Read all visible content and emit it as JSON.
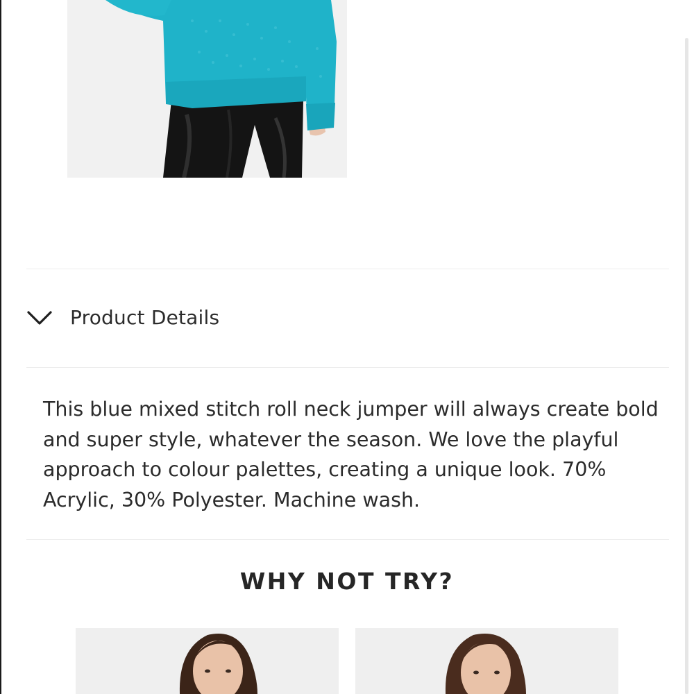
{
  "product": {
    "image_alt": "Model wearing blue mixed stitch roll neck jumper with black trousers"
  },
  "accordion": {
    "label": "Product Details",
    "state": "expanded",
    "icon": "chevron-down-icon"
  },
  "description": {
    "text": "This blue mixed stitch roll neck jumper will always create bold and super style, whatever the season. We love the playful approach to colour palettes, creating a unique look. 70% Acrylic, 30% Polyester. Machine wash."
  },
  "recommendations": {
    "title": "WHY NOT TRY?",
    "items": [
      {
        "image_alt": "Recommended product 1"
      },
      {
        "image_alt": "Recommended product 2"
      }
    ]
  },
  "colors": {
    "jumper": "#1fb3c9",
    "trousers": "#141414",
    "image_bg": "#f1f1f1",
    "text": "#2b2b2b",
    "divider": "#ececec"
  }
}
